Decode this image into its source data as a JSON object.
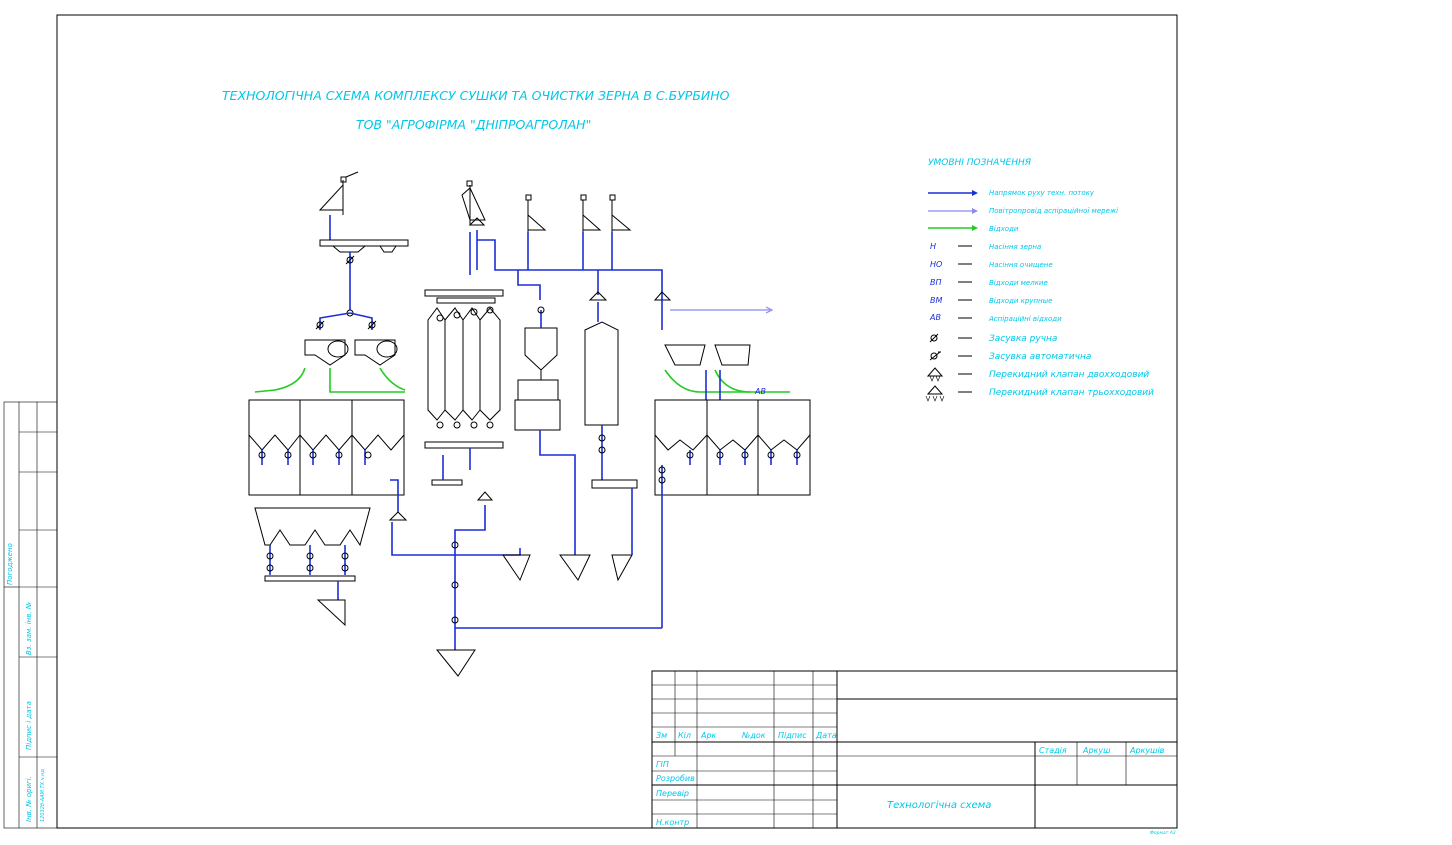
{
  "title": {
    "line1": "ТЕХНОЛОГІЧНА СХЕМА КОМПЛЕКСУ СУШКИ ТА ОЧИСТКИ ЗЕРНА В С.БУРБИНО",
    "line2": "ТОВ \"АГРОФІРМА \"ДНІПРОАГРОЛАН\""
  },
  "legend": {
    "heading": "УМОВНІ ПОЗНАЧЕННЯ",
    "items": [
      {
        "symbol": "",
        "label": "Напрямок руху техн. потоку"
      },
      {
        "symbol": "",
        "label": "Повітропровід аспіраційної мережі"
      },
      {
        "symbol": "",
        "label": "Відходи"
      },
      {
        "symbol": "Н",
        "label": "Насіння зерна"
      },
      {
        "symbol": "НО",
        "label": "Насіння очищене"
      },
      {
        "symbol": "ВП",
        "label": "Відходи мелкие"
      },
      {
        "symbol": "ВМ",
        "label": "Відходи крупные"
      },
      {
        "symbol": "АВ",
        "label": "Аспіраційні відходи"
      },
      {
        "symbol": "",
        "label": "Засувка ручна"
      },
      {
        "symbol": "",
        "label": "Засувка автоматична"
      },
      {
        "symbol": "",
        "label": "Перекидний клапан двохходовий"
      },
      {
        "symbol": "",
        "label": "Перекидний клапан трьохходовий"
      }
    ]
  },
  "scheme": {
    "av_label": "АВ"
  },
  "title_block": {
    "col_headers": [
      "Зм",
      "Кіл",
      "Арк",
      "№док",
      "Підпис",
      "Дата"
    ],
    "roles": [
      "ГІП",
      "Розробив",
      "Перевір",
      "",
      "Н.контр"
    ],
    "stage_headers": [
      "Стадія",
      "Аркуш",
      "Аркушів"
    ],
    "drawing_name": "Технологічна схема",
    "format": "Формат А3"
  },
  "side_stamp": {
    "labels": [
      "Погоджено",
      "Вз. зам. інв. №",
      "Підпис і дата",
      "Інв. № оригі."
    ],
    "ref": "12032б-ААМ.ТХ.ч.нд"
  },
  "colors": {
    "cyan_text": "#00c8e8",
    "flow": "#1a2fd6",
    "aspiration": "#8a8af0",
    "waste": "#22cc22"
  }
}
